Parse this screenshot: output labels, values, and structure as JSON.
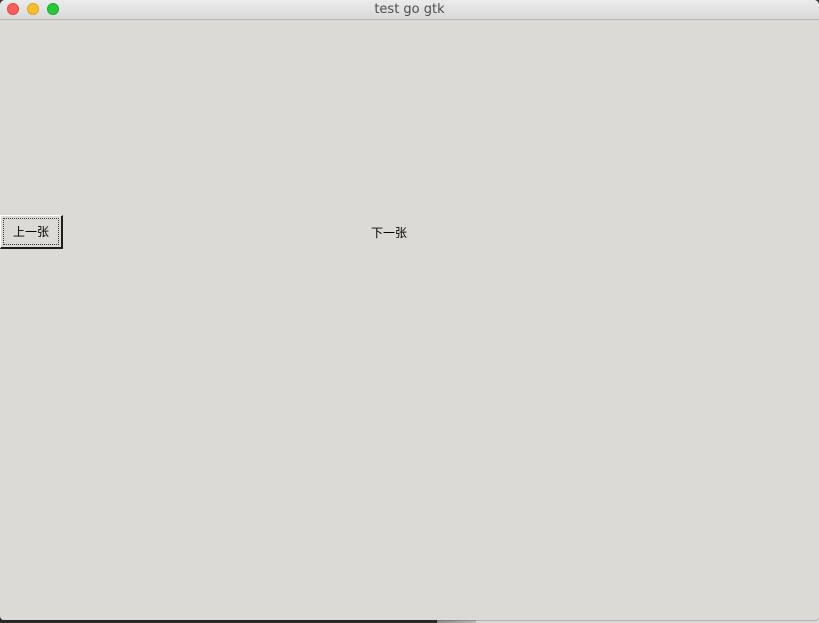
{
  "window": {
    "title": "test go gtk"
  },
  "traffic_lights": {
    "close_color": "#fc5f57",
    "minimize_color": "#fdbc2e",
    "zoom_color": "#28c840"
  },
  "buttons": {
    "prev_label": "上一张",
    "next_label": "下一张"
  }
}
